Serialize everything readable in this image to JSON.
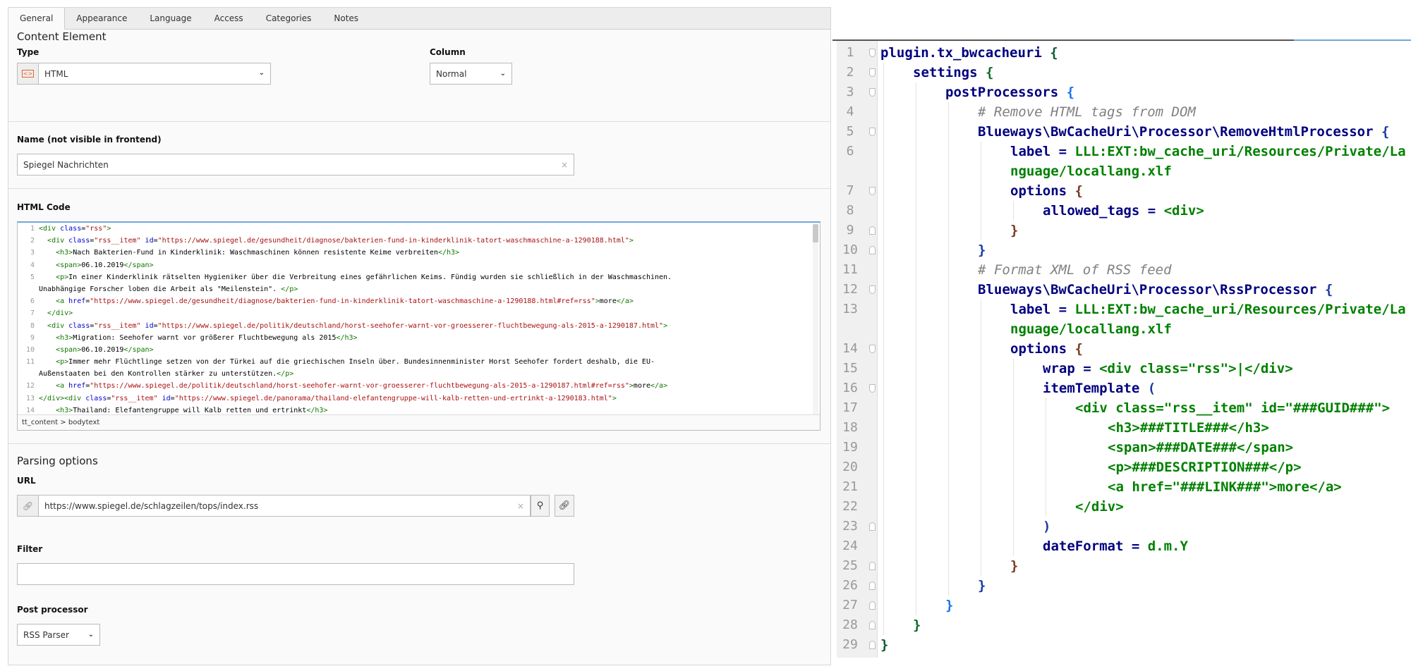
{
  "tabs": [
    "General",
    "Appearance",
    "Language",
    "Access",
    "Categories",
    "Notes"
  ],
  "content_element": {
    "title": "Content Element",
    "type_label": "Type",
    "type_value": "HTML",
    "type_icon": "html-element-icon",
    "column_label": "Column",
    "column_value": "Normal"
  },
  "name": {
    "label": "Name (not visible in frontend)",
    "value": "Spiegel Nachrichten",
    "clear": "×"
  },
  "html_code": {
    "label": "HTML Code",
    "status": "tt_content > bodytext",
    "lines": [
      {
        "n": "1",
        "seg": [
          [
            "tag",
            "<div "
          ],
          [
            "att",
            "class"
          ],
          [
            "txt",
            "="
          ],
          [
            "val",
            "\"rss\""
          ],
          [
            "tag",
            ">"
          ]
        ]
      },
      {
        "n": "2",
        "seg": [
          [
            "txt",
            "  "
          ],
          [
            "tag",
            "<div "
          ],
          [
            "att",
            "class"
          ],
          [
            "txt",
            "="
          ],
          [
            "val",
            "\"rss__item\" "
          ],
          [
            "att",
            "id"
          ],
          [
            "txt",
            "="
          ],
          [
            "val",
            "\"https://www.spiegel.de/gesundheit/diagnose/bakterien-fund-in-kinderklinik-tatort-waschmaschine-a-1290188.html\""
          ],
          [
            "tag",
            ">"
          ]
        ]
      },
      {
        "n": "3",
        "seg": [
          [
            "txt",
            "    "
          ],
          [
            "tag",
            "<h3>"
          ],
          [
            "txt",
            "Nach Bakterien-Fund in Kinderklinik: Waschmaschinen können resistente Keime verbreiten"
          ],
          [
            "tag",
            "</h3>"
          ]
        ]
      },
      {
        "n": "4",
        "seg": [
          [
            "txt",
            "    "
          ],
          [
            "tag",
            "<span>"
          ],
          [
            "txt",
            "06.10.2019"
          ],
          [
            "tag",
            "</span>"
          ]
        ]
      },
      {
        "n": "5",
        "seg": [
          [
            "txt",
            "    "
          ],
          [
            "tag",
            "<p>"
          ],
          [
            "txt",
            "In einer Kinderklinik rätselten Hygieniker über die Verbreitung eines gefährlichen Keims. Fündig wurden sie schließlich in der Waschmaschinen."
          ]
        ]
      },
      {
        "n": "",
        "seg": [
          [
            "txt",
            "Unabhängige Forscher loben die Arbeit als \"Meilenstein\". "
          ],
          [
            "tag",
            "</p>"
          ]
        ]
      },
      {
        "n": "6",
        "seg": [
          [
            "txt",
            "    "
          ],
          [
            "tag",
            "<a "
          ],
          [
            "att",
            "href"
          ],
          [
            "txt",
            "="
          ],
          [
            "val",
            "\"https://www.spiegel.de/gesundheit/diagnose/bakterien-fund-in-kinderklinik-tatort-waschmaschine-a-1290188.html#ref=rss\""
          ],
          [
            "tag",
            ">"
          ],
          [
            "txt",
            "more"
          ],
          [
            "tag",
            "</a>"
          ]
        ]
      },
      {
        "n": "7",
        "seg": [
          [
            "txt",
            "  "
          ],
          [
            "tag",
            "</div>"
          ]
        ]
      },
      {
        "n": "8",
        "seg": [
          [
            "txt",
            "  "
          ],
          [
            "tag",
            "<div "
          ],
          [
            "att",
            "class"
          ],
          [
            "txt",
            "="
          ],
          [
            "val",
            "\"rss__item\" "
          ],
          [
            "att",
            "id"
          ],
          [
            "txt",
            "="
          ],
          [
            "val",
            "\"https://www.spiegel.de/politik/deutschland/horst-seehofer-warnt-vor-groesserer-fluchtbewegung-als-2015-a-1290187.html\""
          ],
          [
            "tag",
            ">"
          ]
        ]
      },
      {
        "n": "9",
        "seg": [
          [
            "txt",
            "    "
          ],
          [
            "tag",
            "<h3>"
          ],
          [
            "txt",
            "Migration: Seehofer warnt vor größerer Fluchtbewegung als 2015"
          ],
          [
            "tag",
            "</h3>"
          ]
        ]
      },
      {
        "n": "10",
        "seg": [
          [
            "txt",
            "    "
          ],
          [
            "tag",
            "<span>"
          ],
          [
            "txt",
            "06.10.2019"
          ],
          [
            "tag",
            "</span>"
          ]
        ]
      },
      {
        "n": "11",
        "seg": [
          [
            "txt",
            "    "
          ],
          [
            "tag",
            "<p>"
          ],
          [
            "txt",
            "Immer mehr Flüchtlinge setzen von der Türkei auf die griechischen Inseln über. Bundesinnenminister Horst Seehofer fordert deshalb, die EU-"
          ]
        ]
      },
      {
        "n": "",
        "seg": [
          [
            "txt",
            "Außenstaaten bei den Kontrollen stärker zu unterstützen."
          ],
          [
            "tag",
            "</p>"
          ]
        ]
      },
      {
        "n": "12",
        "seg": [
          [
            "txt",
            "    "
          ],
          [
            "tag",
            "<a "
          ],
          [
            "att",
            "href"
          ],
          [
            "txt",
            "="
          ],
          [
            "val",
            "\"https://www.spiegel.de/politik/deutschland/horst-seehofer-warnt-vor-groesserer-fluchtbewegung-als-2015-a-1290187.html#ref=rss\""
          ],
          [
            "tag",
            ">"
          ],
          [
            "txt",
            "more"
          ],
          [
            "tag",
            "</a>"
          ]
        ]
      },
      {
        "n": "13",
        "seg": [
          [
            "tag",
            "</div><div "
          ],
          [
            "att",
            "class"
          ],
          [
            "txt",
            "="
          ],
          [
            "val",
            "\"rss__item\" "
          ],
          [
            "att",
            "id"
          ],
          [
            "txt",
            "="
          ],
          [
            "val",
            "\"https://www.spiegel.de/panorama/thailand-elefantengruppe-will-kalb-retten-und-ertrinkt-a-1290183.html\""
          ],
          [
            "tag",
            ">"
          ]
        ]
      },
      {
        "n": "14",
        "seg": [
          [
            "txt",
            "    "
          ],
          [
            "tag",
            "<h3>"
          ],
          [
            "txt",
            "Thailand: Elefantengruppe will Kalb retten und ertrinkt"
          ],
          [
            "tag",
            "</h3>"
          ]
        ]
      }
    ]
  },
  "parsing": {
    "title": "Parsing options",
    "url_label": "URL",
    "url_value": "https://www.spiegel.de/schlagzeilen/tops/index.rss",
    "clear": "×",
    "filter_label": "Filter",
    "filter_value": "",
    "post_label": "Post processor",
    "post_value": "RSS Parser"
  },
  "typoscript": {
    "lines": [
      {
        "n": "1",
        "d": 0,
        "f": "down",
        "seg": [
          [
            "k",
            "plugin.tx_bwcacheuri "
          ],
          [
            "b0",
            "{"
          ]
        ]
      },
      {
        "n": "2",
        "d": 1,
        "f": "down",
        "seg": [
          [
            "k",
            "settings "
          ],
          [
            "b1",
            "{"
          ]
        ]
      },
      {
        "n": "3",
        "d": 2,
        "f": "down",
        "seg": [
          [
            "k",
            "postProcessors "
          ],
          [
            "b2",
            "{"
          ]
        ]
      },
      {
        "n": "4",
        "d": 3,
        "f": "",
        "seg": [
          [
            "c",
            "# Remove HTML tags from DOM"
          ]
        ]
      },
      {
        "n": "5",
        "d": 3,
        "f": "down",
        "seg": [
          [
            "k",
            "Blueways\\BwCacheUri\\Processor\\RemoveHtmlProcessor "
          ],
          [
            "b3",
            "{"
          ]
        ]
      },
      {
        "n": "6",
        "d": 4,
        "f": "",
        "seg": [
          [
            "k",
            "label "
          ],
          [
            "k",
            "= "
          ],
          [
            "s",
            "LLL:EXT:bw_cache_uri/Resources/Private/Language/locallang.xlf"
          ]
        ]
      },
      {
        "n": "7",
        "d": 4,
        "f": "down",
        "seg": [
          [
            "k",
            "options "
          ],
          [
            "b4",
            "{"
          ]
        ]
      },
      {
        "n": "8",
        "d": 5,
        "f": "",
        "seg": [
          [
            "k",
            "allowed_tags "
          ],
          [
            "k",
            "= "
          ],
          [
            "s",
            "<div>"
          ]
        ]
      },
      {
        "n": "9",
        "d": 4,
        "f": "up",
        "seg": [
          [
            "b4",
            "}"
          ]
        ]
      },
      {
        "n": "10",
        "d": 3,
        "f": "up",
        "seg": [
          [
            "b3",
            "}"
          ]
        ]
      },
      {
        "n": "11",
        "d": 3,
        "f": "",
        "seg": [
          [
            "c",
            "# Format XML of RSS feed"
          ]
        ]
      },
      {
        "n": "12",
        "d": 3,
        "f": "down",
        "seg": [
          [
            "k",
            "Blueways\\BwCacheUri\\Processor\\RssProcessor "
          ],
          [
            "b3",
            "{"
          ]
        ]
      },
      {
        "n": "13",
        "d": 4,
        "f": "",
        "seg": [
          [
            "k",
            "label "
          ],
          [
            "k",
            "= "
          ],
          [
            "s",
            "LLL:EXT:bw_cache_uri/Resources/Private/Language/locallang.xlf"
          ]
        ]
      },
      {
        "n": "14",
        "d": 4,
        "f": "down",
        "seg": [
          [
            "k",
            "options "
          ],
          [
            "b4",
            "{"
          ]
        ]
      },
      {
        "n": "15",
        "d": 5,
        "f": "",
        "seg": [
          [
            "k",
            "wrap "
          ],
          [
            "k",
            "= "
          ],
          [
            "s",
            "<div class=\"rss\">|</div>"
          ]
        ]
      },
      {
        "n": "16",
        "d": 5,
        "f": "down",
        "seg": [
          [
            "k",
            "itemTemplate "
          ],
          [
            "b3",
            "("
          ]
        ]
      },
      {
        "n": "17",
        "d": 6,
        "f": "",
        "seg": [
          [
            "s",
            "<div class=\"rss__item\" id=\"###GUID###\">"
          ]
        ]
      },
      {
        "n": "18",
        "d": 7,
        "f": "",
        "seg": [
          [
            "s",
            "<h3>###TITLE###</h3>"
          ]
        ]
      },
      {
        "n": "19",
        "d": 7,
        "f": "",
        "seg": [
          [
            "s",
            "<span>###DATE###</span>"
          ]
        ]
      },
      {
        "n": "20",
        "d": 7,
        "f": "",
        "seg": [
          [
            "s",
            "<p>###DESCRIPTION###</p>"
          ]
        ]
      },
      {
        "n": "21",
        "d": 7,
        "f": "",
        "seg": [
          [
            "s",
            "<a href=\"###LINK###\">more</a>"
          ]
        ]
      },
      {
        "n": "22",
        "d": 6,
        "f": "",
        "seg": [
          [
            "s",
            "</div>"
          ]
        ]
      },
      {
        "n": "23",
        "d": 5,
        "f": "up",
        "seg": [
          [
            "b3",
            ")"
          ]
        ]
      },
      {
        "n": "24",
        "d": 5,
        "f": "",
        "seg": [
          [
            "k",
            "dateFormat "
          ],
          [
            "k",
            "= "
          ],
          [
            "s",
            "d.m.Y"
          ]
        ]
      },
      {
        "n": "25",
        "d": 4,
        "f": "up",
        "seg": [
          [
            "b4",
            "}"
          ]
        ]
      },
      {
        "n": "26",
        "d": 3,
        "f": "up",
        "seg": [
          [
            "b3",
            "}"
          ]
        ]
      },
      {
        "n": "27",
        "d": 2,
        "f": "up",
        "seg": [
          [
            "b2",
            "}"
          ]
        ]
      },
      {
        "n": "28",
        "d": 1,
        "f": "up",
        "seg": [
          [
            "b1",
            "}"
          ]
        ]
      },
      {
        "n": "29",
        "d": 0,
        "f": "up",
        "seg": [
          [
            "b0",
            "}"
          ]
        ]
      }
    ]
  },
  "colors": {
    "accent": "#6fa8dc",
    "keyword": "#000080",
    "string": "#008000",
    "comment": "#808080"
  }
}
